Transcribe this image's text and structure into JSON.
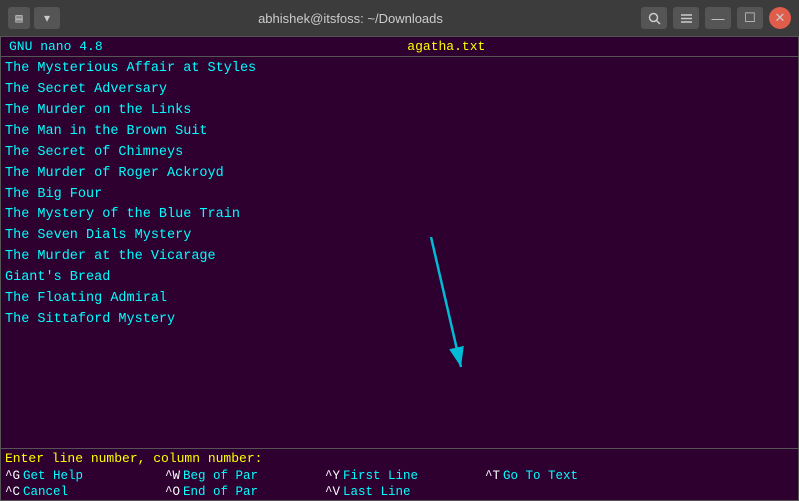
{
  "titlebar": {
    "title": "abhishek@itsfoss: ~/Downloads",
    "app_icon": "▤",
    "dropdown_label": "▾",
    "search_label": "🔍",
    "menu_label": "≡",
    "minimize_label": "—",
    "maximize_label": "☐",
    "close_label": "✕"
  },
  "nano": {
    "header_version": "GNU nano 4.8",
    "header_filename": "agatha.txt",
    "lines": [
      "The Mysterious Affair at Styles",
      "The Secret Adversary",
      "The Murder on the Links",
      "The Man in the Brown Suit",
      "The Secret of Chimneys",
      "The Murder of Roger Ackroyd",
      "The Big Four",
      "The Mystery of the Blue Train",
      "The Seven Dials Mystery",
      "The Murder at the Vicarage",
      "Giant's Bread",
      "The Floating Admiral",
      "The Sittaford Mystery"
    ],
    "prompt_text": "Enter line number, column number: ",
    "shortcuts": [
      [
        {
          "key": "^G",
          "label": "Get Help"
        },
        {
          "key": "^W",
          "label": "Beg of Par"
        },
        {
          "key": "^Y",
          "label": "First Line"
        },
        {
          "key": "^T",
          "label": "Go To Text"
        }
      ],
      [
        {
          "key": "^C",
          "label": "Cancel"
        },
        {
          "key": "^O",
          "label": "End of Par"
        },
        {
          "key": "^V",
          "label": "Last Line"
        },
        {
          "key": "",
          "label": ""
        }
      ]
    ]
  }
}
